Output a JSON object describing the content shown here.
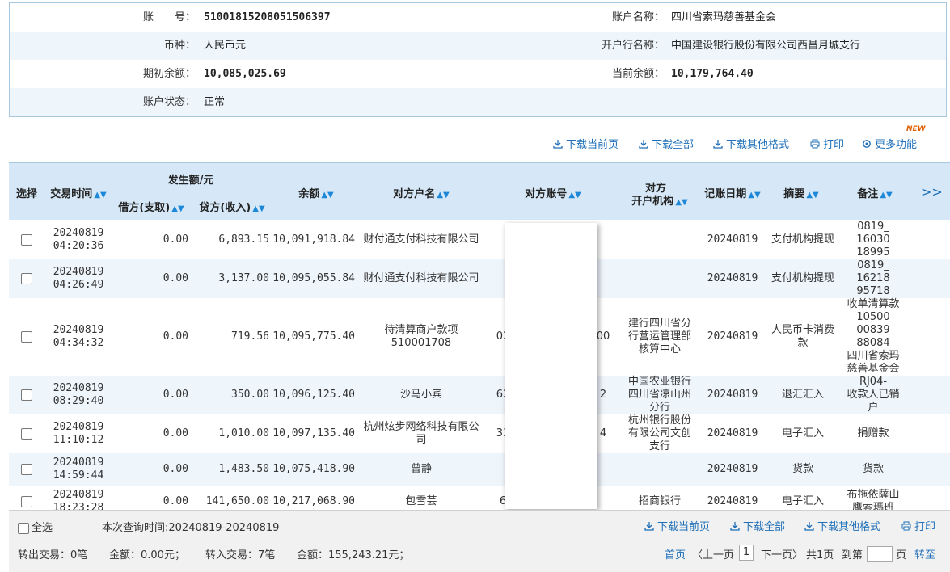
{
  "account_info": {
    "rows": [
      {
        "left_label": "账　　号：",
        "left_value": "51001815208051506397",
        "right_label": "账户名称：",
        "right_value": "四川省索玛慈善基金会"
      },
      {
        "left_label": "币种：",
        "left_value": "人民币元",
        "right_label": "开户行名称：",
        "right_value": "中国建设银行股份有限公司西昌月城支行"
      },
      {
        "left_label": "期初余额：",
        "left_value": "10,085,025.69",
        "right_label": "当前余额：",
        "right_value": "10,179,764.40"
      },
      {
        "left_label": "账户状态：",
        "left_value": "正常",
        "right_label": "",
        "right_value": ""
      }
    ]
  },
  "toolbar_top": {
    "download_page": "下载当前页",
    "download_all": "下载全部",
    "download_other": "下载其他格式",
    "print": "打印",
    "more": "更多功能",
    "new_badge": "NEW"
  },
  "table": {
    "headers": {
      "select": "选择",
      "time": "交易时间",
      "amount_group": "发生额/元",
      "debit": "借方(支取)",
      "credit": "贷方(收入)",
      "balance": "余额",
      "counterparty": "对方户名",
      "account": "对方账号",
      "bank_line1": "对方",
      "bank_line2": "开户机构",
      "date": "记账日期",
      "summary": "摘要",
      "remark": "备注",
      "more": ">>"
    },
    "rows": [
      {
        "date1": "20240819",
        "time": "04:20:36",
        "debit": "0.00",
        "credit": "6,893.15",
        "balance": "10,091,918.84",
        "name": "财付通支付科技有限公司",
        "acct_left": "",
        "acct_right": "",
        "bank": "",
        "book": "20240819",
        "summary": "支付机构提现",
        "remark": "0819_\n16030\n18995"
      },
      {
        "date1": "20240819",
        "time": "04:26:49",
        "debit": "0.00",
        "credit": "3,137.00",
        "balance": "10,095,055.84",
        "name": "财付通支付科技有限公司",
        "acct_left": "",
        "acct_right": "",
        "bank": "",
        "book": "20240819",
        "summary": "支付机构提现",
        "remark": "0819_\n16218\n95718"
      },
      {
        "date1": "20240819",
        "time": "04:34:32",
        "debit": "0.00",
        "credit": "719.56",
        "balance": "10,095,775.40",
        "name": "待清算商户款项510001708",
        "acct_left": "02",
        "acct_right": "00",
        "bank": "建行四川省分行营运管理部核算中心",
        "book": "20240819",
        "summary": "人民币卡消费款",
        "remark": "收单清算款\n10500\n00839\n88084\n四川省索玛\n慈善基金会"
      },
      {
        "date1": "20240819",
        "time": "08:29:40",
        "debit": "0.00",
        "credit": "350.00",
        "balance": "10,096,125.40",
        "name": "沙马小宾",
        "acct_left": "62",
        "acct_right": "2",
        "bank": "中国农业银行四川省凉山州分行",
        "book": "20240819",
        "summary": "退汇汇入",
        "remark": "RJ04-\n收款人已销\n户"
      },
      {
        "date1": "20240819",
        "time": "11:10:12",
        "debit": "0.00",
        "credit": "1,010.00",
        "balance": "10,097,135.40",
        "name": "杭州炫步网络科技有限公司",
        "acct_left": "33",
        "acct_right": "4",
        "bank": "杭州银行股份有限公司文创支行",
        "book": "20240819",
        "summary": "电子汇入",
        "remark": "捐赠款"
      },
      {
        "date1": "20240819",
        "time": "14:59:44",
        "debit": "0.00",
        "credit": "1,483.50",
        "balance": "10,075,418.90",
        "name": "曾静",
        "acct_left": "",
        "acct_right": "",
        "bank": "",
        "book": "20240819",
        "summary": "货款",
        "remark": "货款"
      },
      {
        "date1": "20240819",
        "time": "18:23:28",
        "debit": "0.00",
        "credit": "141,650.00",
        "balance": "10,217,068.90",
        "name": "包雪芸",
        "acct_left": "6",
        "acct_right": "",
        "bank": "招商银行",
        "book": "20240819",
        "summary": "电子汇入",
        "remark": "布拖依薩山\n鹰索瑪班"
      }
    ]
  },
  "footer": {
    "select_all": "全选",
    "query_time": "本次查询时间:20240819-20240819",
    "download_page": "下载当前页",
    "download_all": "下载全部",
    "download_other": "下载其他格式",
    "print": "打印",
    "out_trans": "转出交易：0笔",
    "out_amount": "金额：0.00元；",
    "in_trans": "转入交易：7笔",
    "in_amount": "金额：155,243.21元；",
    "first": "首页",
    "prev": "〈上一页",
    "page_num": "1",
    "next": "下一页〉",
    "total": "共1页",
    "goto": "到第",
    "page_unit": "页",
    "go": "转至"
  }
}
